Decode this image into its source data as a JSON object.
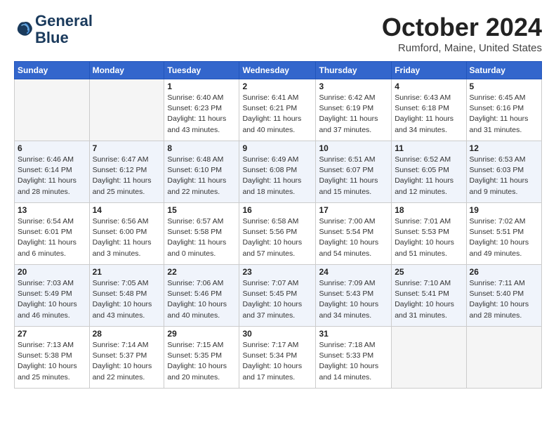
{
  "logo": {
    "line1": "General",
    "line2": "Blue"
  },
  "title": "October 2024",
  "location": "Rumford, Maine, United States",
  "weekdays": [
    "Sunday",
    "Monday",
    "Tuesday",
    "Wednesday",
    "Thursday",
    "Friday",
    "Saturday"
  ],
  "rows": [
    [
      {
        "day": "",
        "sunrise": "",
        "sunset": "",
        "daylight": "",
        "empty": true
      },
      {
        "day": "",
        "sunrise": "",
        "sunset": "",
        "daylight": "",
        "empty": true
      },
      {
        "day": "1",
        "sunrise": "Sunrise: 6:40 AM",
        "sunset": "Sunset: 6:23 PM",
        "daylight": "Daylight: 11 hours and 43 minutes."
      },
      {
        "day": "2",
        "sunrise": "Sunrise: 6:41 AM",
        "sunset": "Sunset: 6:21 PM",
        "daylight": "Daylight: 11 hours and 40 minutes."
      },
      {
        "day": "3",
        "sunrise": "Sunrise: 6:42 AM",
        "sunset": "Sunset: 6:19 PM",
        "daylight": "Daylight: 11 hours and 37 minutes."
      },
      {
        "day": "4",
        "sunrise": "Sunrise: 6:43 AM",
        "sunset": "Sunset: 6:18 PM",
        "daylight": "Daylight: 11 hours and 34 minutes."
      },
      {
        "day": "5",
        "sunrise": "Sunrise: 6:45 AM",
        "sunset": "Sunset: 6:16 PM",
        "daylight": "Daylight: 11 hours and 31 minutes."
      }
    ],
    [
      {
        "day": "6",
        "sunrise": "Sunrise: 6:46 AM",
        "sunset": "Sunset: 6:14 PM",
        "daylight": "Daylight: 11 hours and 28 minutes."
      },
      {
        "day": "7",
        "sunrise": "Sunrise: 6:47 AM",
        "sunset": "Sunset: 6:12 PM",
        "daylight": "Daylight: 11 hours and 25 minutes."
      },
      {
        "day": "8",
        "sunrise": "Sunrise: 6:48 AM",
        "sunset": "Sunset: 6:10 PM",
        "daylight": "Daylight: 11 hours and 22 minutes."
      },
      {
        "day": "9",
        "sunrise": "Sunrise: 6:49 AM",
        "sunset": "Sunset: 6:08 PM",
        "daylight": "Daylight: 11 hours and 18 minutes."
      },
      {
        "day": "10",
        "sunrise": "Sunrise: 6:51 AM",
        "sunset": "Sunset: 6:07 PM",
        "daylight": "Daylight: 11 hours and 15 minutes."
      },
      {
        "day": "11",
        "sunrise": "Sunrise: 6:52 AM",
        "sunset": "Sunset: 6:05 PM",
        "daylight": "Daylight: 11 hours and 12 minutes."
      },
      {
        "day": "12",
        "sunrise": "Sunrise: 6:53 AM",
        "sunset": "Sunset: 6:03 PM",
        "daylight": "Daylight: 11 hours and 9 minutes."
      }
    ],
    [
      {
        "day": "13",
        "sunrise": "Sunrise: 6:54 AM",
        "sunset": "Sunset: 6:01 PM",
        "daylight": "Daylight: 11 hours and 6 minutes."
      },
      {
        "day": "14",
        "sunrise": "Sunrise: 6:56 AM",
        "sunset": "Sunset: 6:00 PM",
        "daylight": "Daylight: 11 hours and 3 minutes."
      },
      {
        "day": "15",
        "sunrise": "Sunrise: 6:57 AM",
        "sunset": "Sunset: 5:58 PM",
        "daylight": "Daylight: 11 hours and 0 minutes."
      },
      {
        "day": "16",
        "sunrise": "Sunrise: 6:58 AM",
        "sunset": "Sunset: 5:56 PM",
        "daylight": "Daylight: 10 hours and 57 minutes."
      },
      {
        "day": "17",
        "sunrise": "Sunrise: 7:00 AM",
        "sunset": "Sunset: 5:54 PM",
        "daylight": "Daylight: 10 hours and 54 minutes."
      },
      {
        "day": "18",
        "sunrise": "Sunrise: 7:01 AM",
        "sunset": "Sunset: 5:53 PM",
        "daylight": "Daylight: 10 hours and 51 minutes."
      },
      {
        "day": "19",
        "sunrise": "Sunrise: 7:02 AM",
        "sunset": "Sunset: 5:51 PM",
        "daylight": "Daylight: 10 hours and 49 minutes."
      }
    ],
    [
      {
        "day": "20",
        "sunrise": "Sunrise: 7:03 AM",
        "sunset": "Sunset: 5:49 PM",
        "daylight": "Daylight: 10 hours and 46 minutes."
      },
      {
        "day": "21",
        "sunrise": "Sunrise: 7:05 AM",
        "sunset": "Sunset: 5:48 PM",
        "daylight": "Daylight: 10 hours and 43 minutes."
      },
      {
        "day": "22",
        "sunrise": "Sunrise: 7:06 AM",
        "sunset": "Sunset: 5:46 PM",
        "daylight": "Daylight: 10 hours and 40 minutes."
      },
      {
        "day": "23",
        "sunrise": "Sunrise: 7:07 AM",
        "sunset": "Sunset: 5:45 PM",
        "daylight": "Daylight: 10 hours and 37 minutes."
      },
      {
        "day": "24",
        "sunrise": "Sunrise: 7:09 AM",
        "sunset": "Sunset: 5:43 PM",
        "daylight": "Daylight: 10 hours and 34 minutes."
      },
      {
        "day": "25",
        "sunrise": "Sunrise: 7:10 AM",
        "sunset": "Sunset: 5:41 PM",
        "daylight": "Daylight: 10 hours and 31 minutes."
      },
      {
        "day": "26",
        "sunrise": "Sunrise: 7:11 AM",
        "sunset": "Sunset: 5:40 PM",
        "daylight": "Daylight: 10 hours and 28 minutes."
      }
    ],
    [
      {
        "day": "27",
        "sunrise": "Sunrise: 7:13 AM",
        "sunset": "Sunset: 5:38 PM",
        "daylight": "Daylight: 10 hours and 25 minutes."
      },
      {
        "day": "28",
        "sunrise": "Sunrise: 7:14 AM",
        "sunset": "Sunset: 5:37 PM",
        "daylight": "Daylight: 10 hours and 22 minutes."
      },
      {
        "day": "29",
        "sunrise": "Sunrise: 7:15 AM",
        "sunset": "Sunset: 5:35 PM",
        "daylight": "Daylight: 10 hours and 20 minutes."
      },
      {
        "day": "30",
        "sunrise": "Sunrise: 7:17 AM",
        "sunset": "Sunset: 5:34 PM",
        "daylight": "Daylight: 10 hours and 17 minutes."
      },
      {
        "day": "31",
        "sunrise": "Sunrise: 7:18 AM",
        "sunset": "Sunset: 5:33 PM",
        "daylight": "Daylight: 10 hours and 14 minutes."
      },
      {
        "day": "",
        "sunrise": "",
        "sunset": "",
        "daylight": "",
        "empty": true
      },
      {
        "day": "",
        "sunrise": "",
        "sunset": "",
        "daylight": "",
        "empty": true
      }
    ]
  ]
}
